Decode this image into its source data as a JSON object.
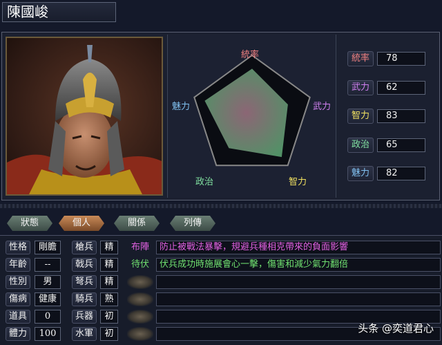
{
  "officer": {
    "name": "陳國峻"
  },
  "radar": {
    "labels": {
      "top": "統率",
      "right": "武力",
      "bottom_right": "智力",
      "bottom_left": "政治",
      "left": "魅力"
    },
    "values": {
      "command": 78,
      "war": 62,
      "intelligence": 83,
      "politics": 65,
      "charm": 82
    },
    "max": 100,
    "colors": {
      "command": "#f08080",
      "war": "#d080f0",
      "intelligence": "#f0e060",
      "politics": "#80e0a0",
      "charm": "#80c0f0"
    }
  },
  "stats": [
    {
      "label": "統率",
      "value": "78",
      "color": "#f08080"
    },
    {
      "label": "武力",
      "value": "62",
      "color": "#d080f0"
    },
    {
      "label": "智力",
      "value": "83",
      "color": "#f0e060"
    },
    {
      "label": "政治",
      "value": "65",
      "color": "#80e0a0"
    },
    {
      "label": "魅力",
      "value": "82",
      "color": "#80c0f0"
    }
  ],
  "tabs": [
    {
      "label": "狀態",
      "active": false
    },
    {
      "label": "個人",
      "active": true
    },
    {
      "label": "關係",
      "active": false
    },
    {
      "label": "列傳",
      "active": false
    }
  ],
  "attributes_left": [
    {
      "label": "性格",
      "value": "剛膽"
    },
    {
      "label": "年齡",
      "value": "--"
    },
    {
      "label": "性別",
      "value": "男"
    },
    {
      "label": "傷病",
      "value": "健康"
    },
    {
      "label": "道具",
      "value": "0"
    },
    {
      "label": "體力",
      "value": "100"
    }
  ],
  "attributes_right": [
    {
      "label": "槍兵",
      "value": "精"
    },
    {
      "label": "戟兵",
      "value": "精"
    },
    {
      "label": "弩兵",
      "value": "精"
    },
    {
      "label": "騎兵",
      "value": "熟"
    },
    {
      "label": "兵器",
      "value": "初"
    },
    {
      "label": "水軍",
      "value": "初"
    }
  ],
  "skills": [
    {
      "name": "布陣",
      "description": "防止被戰法暴擊，規避兵種相克帶來的負面影響",
      "color": "#e060e0"
    },
    {
      "name": "待伏",
      "description": "伏兵成功時施展會心一擊，傷害和減少氣力翻倍",
      "color": "#70e070"
    },
    {
      "name": "",
      "description": ""
    },
    {
      "name": "",
      "description": ""
    },
    {
      "name": "",
      "description": ""
    },
    {
      "name": "",
      "description": ""
    }
  ],
  "watermark": "头条 @奕道君心"
}
